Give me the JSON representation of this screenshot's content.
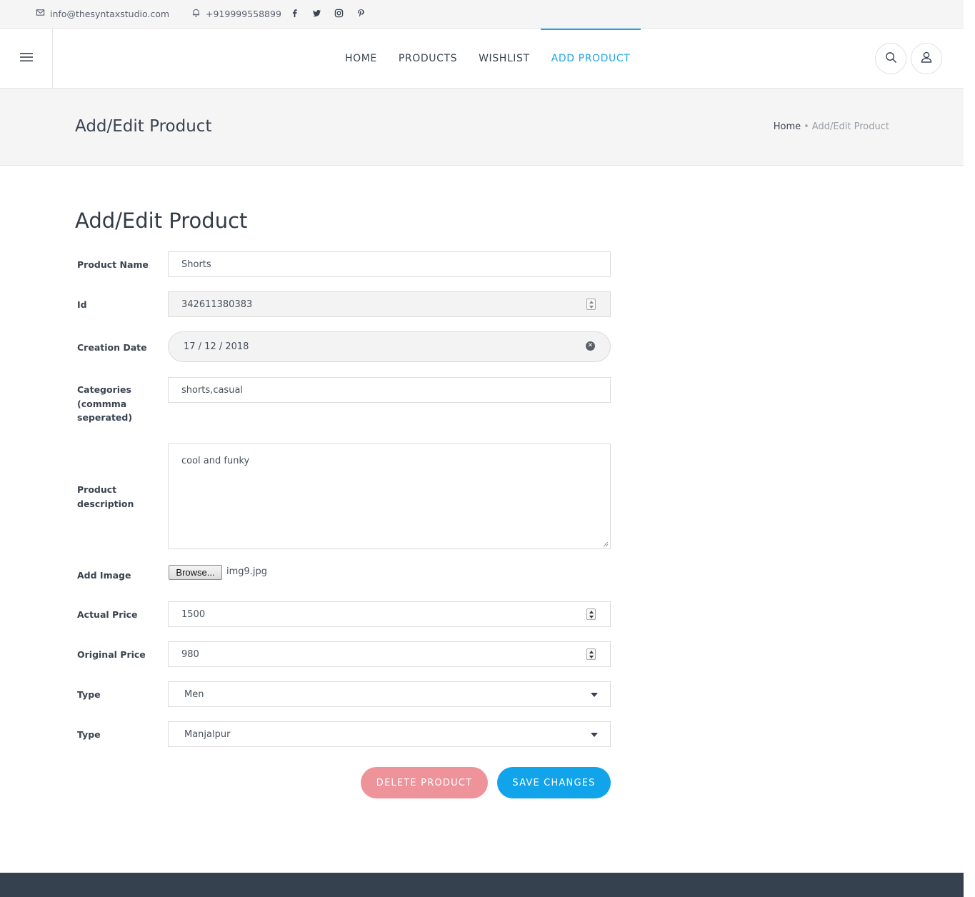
{
  "topbar": {
    "email": "info@thesyntaxstudio.com",
    "phone": "+919999558899",
    "social_icons": [
      "facebook-icon",
      "twitter-icon",
      "instagram-icon",
      "pinterest-icon"
    ]
  },
  "nav": {
    "items": [
      {
        "label": "HOME",
        "active": false
      },
      {
        "label": "PRODUCTS",
        "active": false
      },
      {
        "label": "WISHLIST",
        "active": false
      },
      {
        "label": "ADD PRODUCT",
        "active": true
      }
    ],
    "accent_color": "#1ea6e6"
  },
  "page_header": {
    "title": "Add/Edit Product",
    "breadcrumb": {
      "home": "Home",
      "separator": "•",
      "current": "Add/Edit Product"
    }
  },
  "form": {
    "title": "Add/Edit Product",
    "product_name": {
      "label": "Product Name",
      "value": "Shorts"
    },
    "id": {
      "label": "Id",
      "value": "342611380383"
    },
    "creation_date": {
      "label": "Creation Date",
      "value": "17 / 12 / 2018"
    },
    "categories": {
      "label_line1": "Categories",
      "label_line2": "(commma",
      "label_line3": "seperated)",
      "value": "shorts,casual"
    },
    "description": {
      "label_line1": "Product",
      "label_line2": "description",
      "value": "cool and funky"
    },
    "image": {
      "label": "Add Image",
      "button": "Browse...",
      "filename": "img9.jpg"
    },
    "actual_price": {
      "label": "Actual Price",
      "value": "1500"
    },
    "original_price": {
      "label": "Original Price",
      "value": "980"
    },
    "type1": {
      "label": "Type",
      "value": "Men"
    },
    "type2": {
      "label": "Type",
      "value": "Manjalpur"
    },
    "delete_button": "DELETE PRODUCT",
    "save_button": "SAVE CHANGES",
    "delete_color": "#ef939b",
    "save_color": "#12a4ea"
  }
}
